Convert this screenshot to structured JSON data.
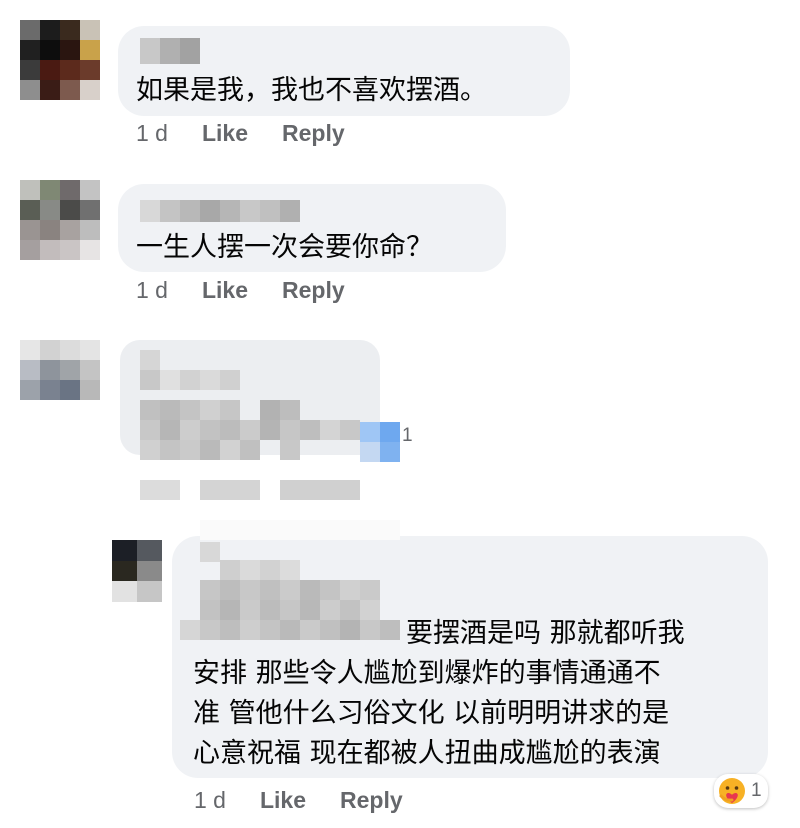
{
  "comments": [
    {
      "text": "如果是我，我也不喜欢摆酒。",
      "time": "1 d",
      "like": "Like",
      "reply": "Reply"
    },
    {
      "text": "一生人摆一次会要你命？",
      "time": "1 d",
      "like": "Like",
      "reply": "Reply"
    },
    {
      "reaction_count": "1"
    }
  ],
  "reply": {
    "lines": [
      "要摆酒是吗 那就都听我",
      "安排 那些令人尴尬到爆炸的事情通通不",
      "准 管他什么习俗文化 以前明明讲求的是",
      "心意祝福 现在都被人扭曲成尴尬的表演"
    ],
    "time": "1 d",
    "like": "Like",
    "reply": "Reply",
    "reaction_count": "1",
    "reaction_icon": "care-reaction-icon"
  },
  "colors": {
    "bubble": "#f0f2f5",
    "meta_text": "#65676b",
    "text": "#050505"
  }
}
